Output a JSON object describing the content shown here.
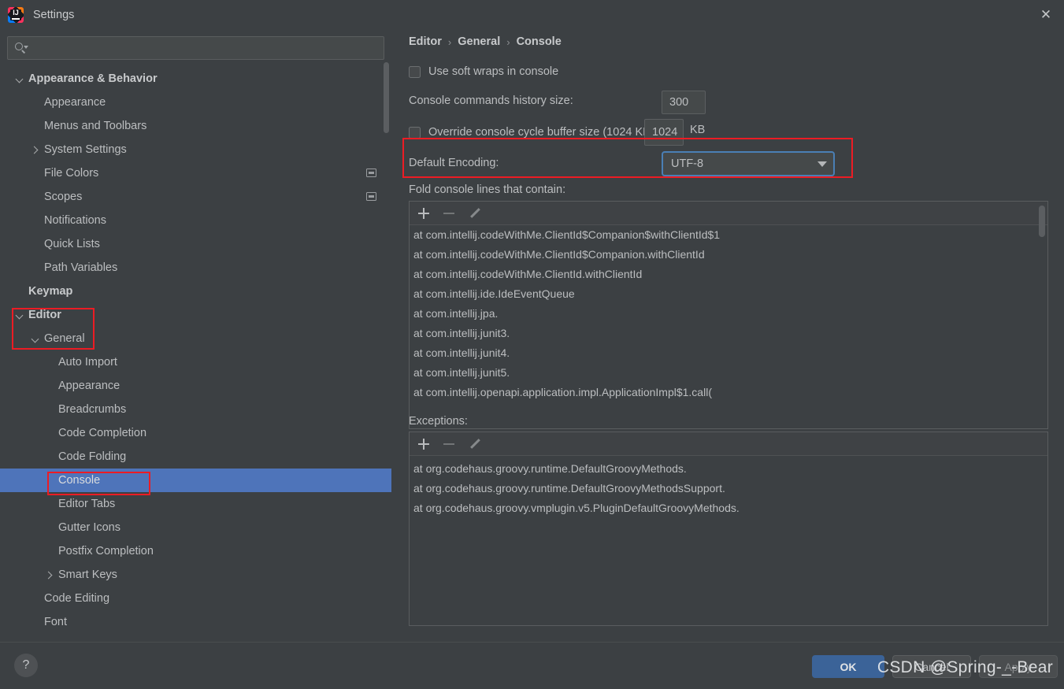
{
  "window": {
    "title": "Settings",
    "logo_icon": "intellij-idea-logo",
    "close_icon": "close-icon"
  },
  "sidebar": {
    "search": {
      "placeholder": "",
      "value": "",
      "icon": "search-icon"
    },
    "items": [
      {
        "label": "Appearance & Behavior",
        "indent": 0,
        "chevron": "down",
        "bold": true,
        "selected": false,
        "icon": null
      },
      {
        "label": "Appearance",
        "indent": 1,
        "chevron": "none",
        "bold": false,
        "selected": false,
        "icon": null
      },
      {
        "label": "Menus and Toolbars",
        "indent": 1,
        "chevron": "none",
        "bold": false,
        "selected": false,
        "icon": null
      },
      {
        "label": "System Settings",
        "indent": 1,
        "chevron": "right",
        "bold": false,
        "selected": false,
        "icon": null
      },
      {
        "label": "File Colors",
        "indent": 1,
        "chevron": "none",
        "bold": false,
        "selected": false,
        "icon": "monitor-icon"
      },
      {
        "label": "Scopes",
        "indent": 1,
        "chevron": "none",
        "bold": false,
        "selected": false,
        "icon": "monitor-icon"
      },
      {
        "label": "Notifications",
        "indent": 1,
        "chevron": "none",
        "bold": false,
        "selected": false,
        "icon": null
      },
      {
        "label": "Quick Lists",
        "indent": 1,
        "chevron": "none",
        "bold": false,
        "selected": false,
        "icon": null
      },
      {
        "label": "Path Variables",
        "indent": 1,
        "chevron": "none",
        "bold": false,
        "selected": false,
        "icon": null
      },
      {
        "label": "Keymap",
        "indent": 0,
        "chevron": "none",
        "bold": true,
        "selected": false,
        "icon": null
      },
      {
        "label": "Editor",
        "indent": 0,
        "chevron": "down",
        "bold": true,
        "selected": false,
        "icon": null
      },
      {
        "label": "General",
        "indent": 1,
        "chevron": "down",
        "bold": false,
        "selected": false,
        "icon": null
      },
      {
        "label": "Auto Import",
        "indent": 2,
        "chevron": "none",
        "bold": false,
        "selected": false,
        "icon": null
      },
      {
        "label": "Appearance",
        "indent": 2,
        "chevron": "none",
        "bold": false,
        "selected": false,
        "icon": null
      },
      {
        "label": "Breadcrumbs",
        "indent": 2,
        "chevron": "none",
        "bold": false,
        "selected": false,
        "icon": null
      },
      {
        "label": "Code Completion",
        "indent": 2,
        "chevron": "none",
        "bold": false,
        "selected": false,
        "icon": null
      },
      {
        "label": "Code Folding",
        "indent": 2,
        "chevron": "none",
        "bold": false,
        "selected": false,
        "icon": null
      },
      {
        "label": "Console",
        "indent": 2,
        "chevron": "none",
        "bold": false,
        "selected": true,
        "icon": null
      },
      {
        "label": "Editor Tabs",
        "indent": 2,
        "chevron": "none",
        "bold": false,
        "selected": false,
        "icon": null
      },
      {
        "label": "Gutter Icons",
        "indent": 2,
        "chevron": "none",
        "bold": false,
        "selected": false,
        "icon": null
      },
      {
        "label": "Postfix Completion",
        "indent": 2,
        "chevron": "none",
        "bold": false,
        "selected": false,
        "icon": null
      },
      {
        "label": "Smart Keys",
        "indent": 2,
        "chevron": "right",
        "bold": false,
        "selected": false,
        "icon": null
      },
      {
        "label": "Code Editing",
        "indent": 1,
        "chevron": "none",
        "bold": false,
        "selected": false,
        "icon": null
      },
      {
        "label": "Font",
        "indent": 1,
        "chevron": "none",
        "bold": false,
        "selected": false,
        "icon": null
      }
    ]
  },
  "content": {
    "breadcrumb": {
      "root": "Editor",
      "mid": "General",
      "leaf": "Console",
      "separator": "›"
    },
    "soft_wraps": {
      "label": "Use soft wraps in console",
      "checked": false
    },
    "history_size": {
      "label": "Console commands history size:",
      "value": "300"
    },
    "cycle_buffer": {
      "label": "Override console cycle buffer size (1024 KB)",
      "checked": false,
      "value": "1024",
      "unit": "KB"
    },
    "default_encoding": {
      "label": "Default Encoding:",
      "value": "UTF-8",
      "arrow_icon": "chevron-down-icon"
    },
    "fold_section": {
      "label": "Fold console lines that contain:",
      "toolbar": {
        "add_icon": "plus-icon",
        "remove_icon": "minus-icon",
        "edit_icon": "pencil-icon"
      },
      "lines": [
        "at com.intellij.codeWithMe.ClientId$Companion$withClientId$1",
        "at com.intellij.codeWithMe.ClientId$Companion.withClientId",
        "at com.intellij.codeWithMe.ClientId.withClientId",
        "at com.intellij.ide.IdeEventQueue",
        "at com.intellij.jpa.",
        "at com.intellij.junit3.",
        "at com.intellij.junit4.",
        "at com.intellij.junit5.",
        "at com.intellij.openapi.application.impl.ApplicationImpl$1.call("
      ]
    },
    "exceptions_section": {
      "label": "Exceptions:",
      "toolbar": {
        "add_icon": "plus-icon",
        "remove_icon": "minus-icon",
        "edit_icon": "pencil-icon"
      },
      "lines": [
        "at org.codehaus.groovy.runtime.DefaultGroovyMethods.",
        "at org.codehaus.groovy.runtime.DefaultGroovyMethodsSupport.",
        "at org.codehaus.groovy.vmplugin.v5.PluginDefaultGroovyMethods."
      ]
    }
  },
  "footer": {
    "help_label": "?",
    "ok_label": "OK",
    "cancel_label": "Cancel",
    "apply_label": "Apply"
  },
  "watermark": {
    "text": "CSDN @Spring-_-Bear"
  },
  "colors": {
    "background": "#3c4043",
    "selection_blue": "#4e74ba",
    "annotation_red": "#ec1c24",
    "ok_button_blue": "#3b6398",
    "focus_ring_blue": "#4a7fb5"
  }
}
